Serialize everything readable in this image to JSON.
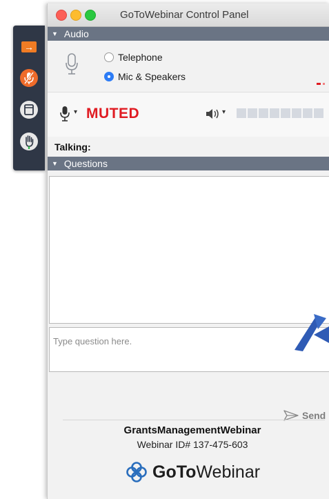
{
  "window": {
    "title": "GoToWebinar Control Panel"
  },
  "audio": {
    "header": "Audio",
    "options": [
      {
        "label": "Telephone",
        "selected": false
      },
      {
        "label": "Mic & Speakers",
        "selected": true
      }
    ],
    "mute_status": "MUTED",
    "talking_label": "Talking:"
  },
  "questions": {
    "header": "Questions",
    "input_placeholder": "Type question here.",
    "send_label": "Send"
  },
  "footer": {
    "webinar_name": "GrantsManagementWebinar",
    "webinar_id": "Webinar ID# 137-475-603",
    "brand_bold": "GoTo",
    "brand_regular": "Webinar"
  },
  "colors": {
    "accent_orange": "#f07c24",
    "muted_red": "#e01b22",
    "header_gray": "#6a7484",
    "toolbar_dark": "#2f3746",
    "arrow_blue": "#2f5bb5"
  },
  "icons": [
    "microphone-icon",
    "speaker-icon",
    "send-icon",
    "arrow-right-icon",
    "mic-muted-icon",
    "screen-icon",
    "raise-hand-icon",
    "gotowebinar-logo-icon"
  ]
}
